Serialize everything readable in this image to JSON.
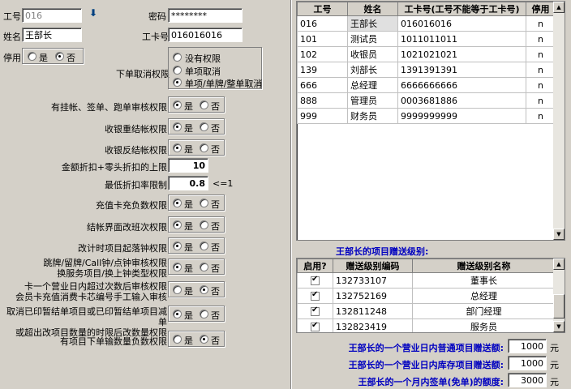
{
  "form": {
    "id_label": "工号",
    "id_value": "016",
    "password_label": "密码",
    "password_value": "********",
    "name_label": "姓名",
    "name_value": "王部长",
    "card_label": "工卡号",
    "card_value": "016016016",
    "disabled_label": "停用",
    "yes": "是",
    "no": "否",
    "cancel_perm_label": "下单取消权限",
    "cancel_perm_options": [
      "没有权限",
      "单项取消",
      "单项/单牌/整单取消"
    ],
    "perm_rows": [
      {
        "label": "有挂帐、签单、跑单审核权限",
        "sel": "yes"
      },
      {
        "label": "收银重结帐权限",
        "sel": "yes"
      },
      {
        "label": "收银反结帐权限",
        "sel": "yes"
      }
    ],
    "discount_limit_label": "金额折扣+零头折扣的上限",
    "discount_limit_value": "10",
    "min_rate_label": "最低折扣率限制",
    "min_rate_value": "0.8",
    "min_rate_hint": "<=1",
    "perm_rows2": [
      {
        "label": "充值卡充负数权限",
        "sel": "yes"
      },
      {
        "label": "结帐界面改班次权限",
        "sel": "yes"
      },
      {
        "label": "改计时项目起落钟权限",
        "sel": "yes"
      }
    ],
    "perm_multi": [
      {
        "line1": "跳牌/留牌/Call钟/点钟审核权限",
        "line2": "换服务项目/换上钟类型权限",
        "sel": "yes"
      },
      {
        "line1": "卡一个营业日内超过次数后审核权限",
        "line2": "会员卡充值消费卡芯编号手工输入审核",
        "sel": "no"
      },
      {
        "line1": "取消已印暂结单项目或已印暂结单项目减单",
        "line2": "或超出改项目数量的时限后改数量权限",
        "sel": "yes"
      }
    ],
    "last_perm": {
      "label": "有项目下单输数量负数权限",
      "sel": "no"
    }
  },
  "staff_table": {
    "headers": [
      "工号",
      "姓名",
      "工卡号(工号不能等于工卡号)",
      "停用"
    ],
    "rows": [
      [
        "016",
        "王部长",
        "016016016",
        "n"
      ],
      [
        "101",
        "测试员",
        "1011011011",
        "n"
      ],
      [
        "102",
        "收银员",
        "1021021021",
        "n"
      ],
      [
        "139",
        "刘部长",
        "1391391391",
        "n"
      ],
      [
        "666",
        "总经理",
        "6666666666",
        "n"
      ],
      [
        "888",
        "管理员",
        "0003681886",
        "n"
      ],
      [
        "999",
        "财务员",
        "9999999999",
        "n"
      ]
    ]
  },
  "gift_title": "王部长的项目赠送级别:",
  "gift_table": {
    "headers": [
      "启用?",
      "赠送级别编码",
      "赠送级别名称"
    ],
    "rows": [
      [
        "132733107",
        "董事长"
      ],
      [
        "132752169",
        "总经理"
      ],
      [
        "132811248",
        "部门经理"
      ],
      [
        "132823419",
        "服务员"
      ]
    ]
  },
  "quota": [
    {
      "label": "王部长的一个营业日内普通项目赠送额:",
      "value": "1000",
      "unit": "元"
    },
    {
      "label": "王部长的一个营业日内库存项目赠送额:",
      "value": "1000",
      "unit": "元"
    },
    {
      "label": "王部长的一个月内签单(免单)的额度:",
      "value": "3000",
      "unit": "元"
    }
  ]
}
